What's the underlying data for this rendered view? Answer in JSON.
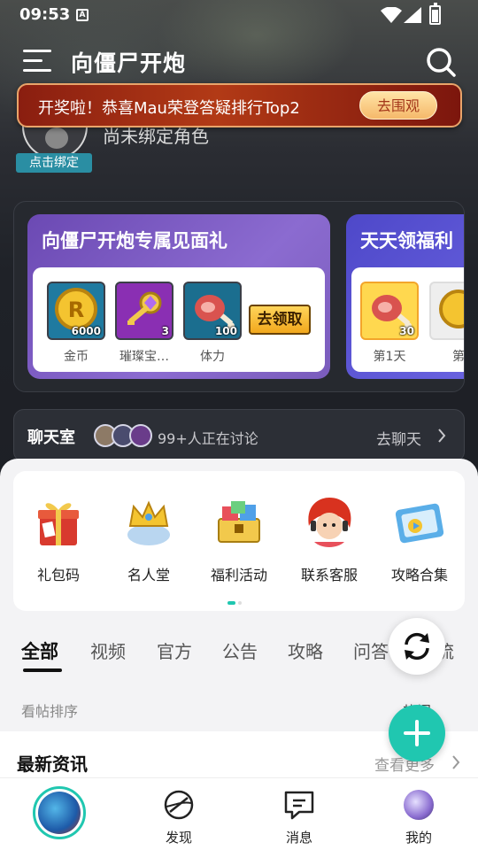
{
  "status_bar": {
    "time": "09:53",
    "sim_badge": "A"
  },
  "header": {
    "title": "向僵尸开炮"
  },
  "banner": {
    "text": "开奖啦！恭喜Mau荣登答疑排行Top2",
    "button": "去围观"
  },
  "binding": {
    "label": "点击绑定",
    "role_text": "尚未绑定角色"
  },
  "gift_cards": [
    {
      "title": "向僵尸开炮专属见面礼",
      "rewards": [
        {
          "name": "金币",
          "qty": "6000",
          "icon": "gold-coin-icon"
        },
        {
          "name": "璀璨宝…",
          "qty": "3",
          "icon": "gem-key-icon"
        },
        {
          "name": "体力",
          "qty": "100",
          "icon": "meat-leg-icon"
        }
      ],
      "claim_button": "去领取"
    },
    {
      "title": "天天领福利",
      "rewards": [
        {
          "name": "第1天",
          "qty": "30",
          "icon": "meat-leg-icon"
        },
        {
          "name": "第",
          "qty": "",
          "icon": "gold-coin-icon"
        }
      ]
    }
  ],
  "chat": {
    "title": "聊天室",
    "count_text": "99+人正在讨论",
    "go_text": "去聊天"
  },
  "quick_actions": [
    {
      "label": "礼包码",
      "icon": "gift-box-icon"
    },
    {
      "label": "名人堂",
      "icon": "crown-icon"
    },
    {
      "label": "福利活动",
      "icon": "treasure-chest-icon"
    },
    {
      "label": "联系客服",
      "icon": "support-agent-icon"
    },
    {
      "label": "攻略合集",
      "icon": "guide-folder-icon"
    }
  ],
  "tabs": [
    "全部",
    "视频",
    "官方",
    "公告",
    "攻略",
    "问答",
    "交流"
  ],
  "active_tab": "全部",
  "sort": {
    "label": "看帖排序",
    "value": "热门"
  },
  "news": {
    "title": "最新资讯",
    "more": "查看更多"
  },
  "bottom_nav": [
    {
      "label": "",
      "icon": "game-avatar-icon"
    },
    {
      "label": "发现",
      "icon": "compass-icon"
    },
    {
      "label": "消息",
      "icon": "message-icon"
    },
    {
      "label": "我的",
      "icon": "user-avatar-icon"
    }
  ],
  "colors": {
    "accent": "#20c7b0",
    "banner_red": "#b23a16",
    "card_purple": "#7a5cbc",
    "card_indigo": "#5a54d6"
  }
}
